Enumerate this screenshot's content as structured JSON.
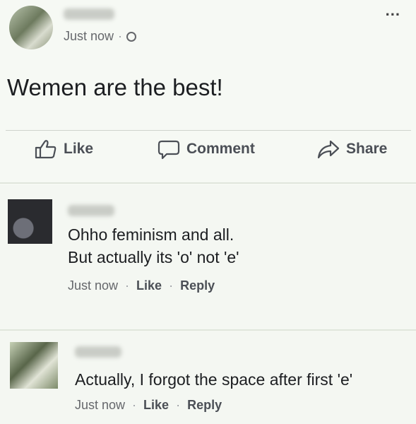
{
  "post": {
    "timestamp": "Just now",
    "separator": "·",
    "more_menu": "...",
    "text": "Wemen are the best!",
    "icons": {
      "privacy": "globe-icon",
      "more": "more-options-icon"
    }
  },
  "actions": {
    "like": "Like",
    "comment": "Comment",
    "share": "Share"
  },
  "comments": [
    {
      "lines": [
        "Ohho feminism and all.",
        "But actually its 'o' not 'e'"
      ],
      "timestamp": "Just now",
      "like": "Like",
      "reply": "Reply",
      "separator": "·"
    },
    {
      "lines": [
        "Actually, I forgot the space after first 'e'"
      ],
      "timestamp": "Just now",
      "like": "Like",
      "reply": "Reply",
      "separator": "·"
    }
  ],
  "colors": {
    "background": "#f4f7f2",
    "text": "#1c1e21",
    "muted": "#65676b"
  }
}
